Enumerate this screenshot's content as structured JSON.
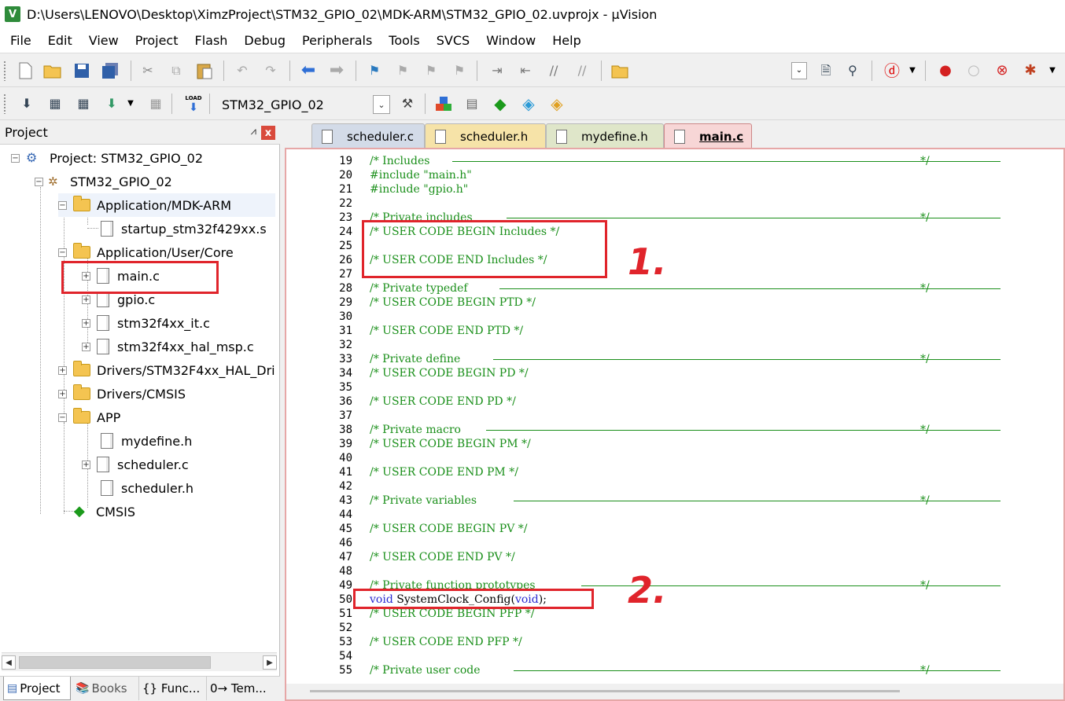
{
  "window": {
    "title": "D:\\Users\\LENOVO\\Desktop\\XimzProject\\STM32_GPIO_02\\MDK-ARM\\STM32_GPIO_02.uvprojx - µVision",
    "app_icon": "V"
  },
  "menu": [
    "File",
    "Edit",
    "View",
    "Project",
    "Flash",
    "Debug",
    "Peripherals",
    "Tools",
    "SVCS",
    "Window",
    "Help"
  ],
  "toolbar2": {
    "target": "STM32_GPIO_02",
    "load_label": "LOAD"
  },
  "project_panel": {
    "title": "Project",
    "pin": "⩘",
    "close": "x",
    "tree": [
      {
        "label": "Project: STM32_GPIO_02"
      },
      {
        "label": "STM32_GPIO_02"
      },
      {
        "label": "Application/MDK-ARM"
      },
      {
        "label": "startup_stm32f429xx.s"
      },
      {
        "label": "Application/User/Core"
      },
      {
        "label": "main.c"
      },
      {
        "label": "gpio.c"
      },
      {
        "label": "stm32f4xx_it.c"
      },
      {
        "label": "stm32f4xx_hal_msp.c"
      },
      {
        "label": "Drivers/STM32F4xx_HAL_Dri"
      },
      {
        "label": "Drivers/CMSIS"
      },
      {
        "label": "APP"
      },
      {
        "label": "mydefine.h"
      },
      {
        "label": "scheduler.c"
      },
      {
        "label": "scheduler.h"
      },
      {
        "label": "CMSIS"
      }
    ],
    "bottom_tabs": [
      "Project",
      "Books",
      "{} Func...",
      "0→ Tem..."
    ]
  },
  "editor": {
    "tabs": [
      "scheduler.c",
      "scheduler.h",
      "mydefine.h",
      "main.c"
    ],
    "active_tab": "main.c",
    "lines": [
      {
        "n": "19",
        "t": "/* Includes "
      },
      {
        "n": "20",
        "t": "#include \"main.h\""
      },
      {
        "n": "21",
        "t": "#include \"gpio.h\""
      },
      {
        "n": "22",
        "t": ""
      },
      {
        "n": "23",
        "t": "/* Private includes "
      },
      {
        "n": "24",
        "t": "/* USER CODE BEGIN Includes */"
      },
      {
        "n": "25",
        "t": ""
      },
      {
        "n": "26",
        "t": "/* USER CODE END Includes */"
      },
      {
        "n": "27",
        "t": ""
      },
      {
        "n": "28",
        "t": "/* Private typedef "
      },
      {
        "n": "29",
        "t": "/* USER CODE BEGIN PTD */"
      },
      {
        "n": "30",
        "t": ""
      },
      {
        "n": "31",
        "t": "/* USER CODE END PTD */"
      },
      {
        "n": "32",
        "t": ""
      },
      {
        "n": "33",
        "t": "/* Private define "
      },
      {
        "n": "34",
        "t": "/* USER CODE BEGIN PD */"
      },
      {
        "n": "35",
        "t": ""
      },
      {
        "n": "36",
        "t": "/* USER CODE END PD */"
      },
      {
        "n": "37",
        "t": ""
      },
      {
        "n": "38",
        "t": "/* Private macro "
      },
      {
        "n": "39",
        "t": "/* USER CODE BEGIN PM */"
      },
      {
        "n": "40",
        "t": ""
      },
      {
        "n": "41",
        "t": "/* USER CODE END PM */"
      },
      {
        "n": "42",
        "t": ""
      },
      {
        "n": "43",
        "t": "/* Private variables "
      },
      {
        "n": "44",
        "t": ""
      },
      {
        "n": "45",
        "t": "/* USER CODE BEGIN PV */"
      },
      {
        "n": "46",
        "t": ""
      },
      {
        "n": "47",
        "t": "/* USER CODE END PV */"
      },
      {
        "n": "48",
        "t": ""
      },
      {
        "n": "49",
        "t": "/* Private function prototypes "
      },
      {
        "n": "50",
        "t": "void SystemClock_Config(void);"
      },
      {
        "n": "51",
        "t": "/* USER CODE BEGIN PFP */"
      },
      {
        "n": "52",
        "t": ""
      },
      {
        "n": "53",
        "t": "/* USER CODE END PFP */"
      },
      {
        "n": "54",
        "t": ""
      },
      {
        "n": "55",
        "t": "/* Private user code "
      }
    ],
    "rule_end": "*/"
  },
  "annotations": [
    "1.",
    "2."
  ]
}
